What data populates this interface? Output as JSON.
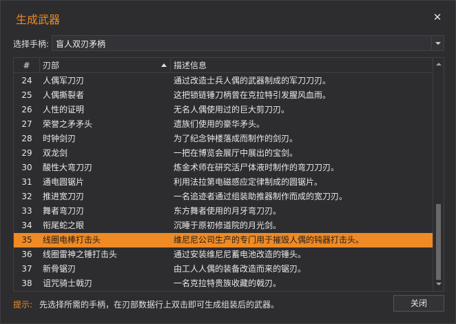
{
  "window": {
    "title": "生成武器",
    "close_glyph": "✕"
  },
  "selector": {
    "label": "选择手柄:",
    "value": "盲人双刃矛柄"
  },
  "table": {
    "columns": [
      "#",
      "刃部",
      "描述信息"
    ],
    "sorted_column": "刃部",
    "sort_direction": "ascending",
    "selected_index": 11,
    "rows": [
      {
        "num": "24",
        "blade": "人偶军刀刃",
        "desc": "通过改造士兵人偶的武器制成的军刀刀刃。"
      },
      {
        "num": "25",
        "blade": "人偶撕裂者",
        "desc": "这把锁链锤刀柄曾在克拉特引发腥风血雨。"
      },
      {
        "num": "26",
        "blade": "人性的证明",
        "desc": "无名人偶使用过的巨大剪刀刃。"
      },
      {
        "num": "27",
        "blade": "荣誉之矛矛头",
        "desc": "遗族们使用的豪华矛头。"
      },
      {
        "num": "28",
        "blade": "时钟剑刃",
        "desc": "为了纪念钟楼落成而制作的剑刃。"
      },
      {
        "num": "29",
        "blade": "双龙剑",
        "desc": "一把在博览会展厅中展出的宝剑。"
      },
      {
        "num": "30",
        "blade": "酸性大弯刀刃",
        "desc": "炼金术师在研究活尸体液时制作的弯刀刀刃。"
      },
      {
        "num": "31",
        "blade": "通电圆锯片",
        "desc": "利用法拉第电磁感应定律制成的圆锯片。"
      },
      {
        "num": "32",
        "blade": "推进宽刀刃",
        "desc": "一名追迹者通过组装助推器制作而成的宽刀刃。"
      },
      {
        "num": "33",
        "blade": "舞者弯刀刃",
        "desc": "东方舞者使用的月牙弯刀刃。"
      },
      {
        "num": "34",
        "blade": "衔尾蛇之眼",
        "desc": "沉睡于原初修道院的月光剑。"
      },
      {
        "num": "35",
        "blade": "线圈电棒打击头",
        "desc": "维尼尼公司生产的专门用于摧毁人偶的钝器打击头。"
      },
      {
        "num": "36",
        "blade": "线圈雷神之锤打击头",
        "desc": "通过安装维尼尼蓄电池改造的锤头。"
      },
      {
        "num": "37",
        "blade": "新骨锯刃",
        "desc": "由工人人偶的装备改造而来的锯刃。"
      },
      {
        "num": "38",
        "blade": "诅咒骑士戟刃",
        "desc": "一名克拉特贵族收藏的戟刃。"
      }
    ]
  },
  "footer": {
    "hint_label": "提示:",
    "hint_text": "先选择所需的手柄，在刃部数据行上双击即可生成组装后的武器。",
    "close_label": "关闭"
  },
  "colors": {
    "accent": "#f08a24",
    "background": "#2d2d30",
    "border": "#3f3f46"
  },
  "icons": [
    "close-icon",
    "dropdown-arrow-icon",
    "sort-ascending-icon",
    "scroll-up-icon",
    "scroll-down-icon"
  ]
}
